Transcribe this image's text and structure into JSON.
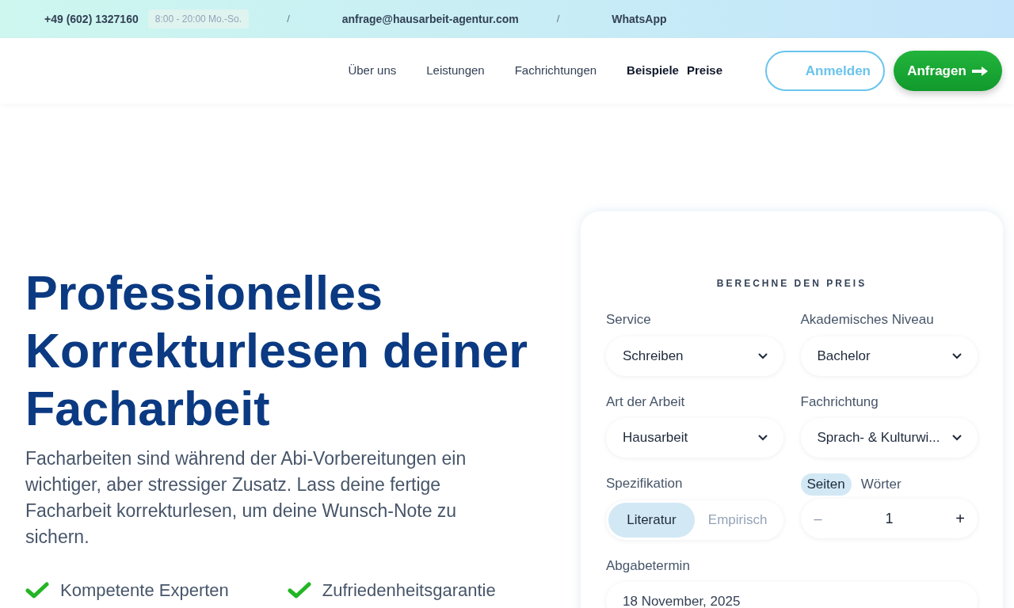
{
  "top_bar": {
    "phone": "+49 (602) 1327160",
    "hours": "8:00 - 20:00 Mo.-So.",
    "separator": "/",
    "email": "anfrage@hausarbeit-agentur.com",
    "whatsapp": "WhatsApp"
  },
  "nav": {
    "links": [
      {
        "label": "Über uns",
        "highlighted": false
      },
      {
        "label": "Leistungen",
        "highlighted": false
      },
      {
        "label": "Fachrichtungen",
        "highlighted": false
      },
      {
        "label": "Beispiele",
        "highlighted": true
      },
      {
        "label": "Preise",
        "highlighted": true
      }
    ],
    "login_button": "Anmelden",
    "request_button": "Anfragen"
  },
  "hero": {
    "title": "Professionelles Korrekturlesen deiner Facharbeit",
    "description": "Facharbeiten sind während der Abi-Vorbereitungen ein wichtiger, aber stressiger Zusatz. Lass deine fertige Facharbeit korrekturlesen, um deine Wunsch-Note zu sichern.",
    "features": [
      "Kompetente Experten",
      "Zufriedenheitsgarantie"
    ]
  },
  "calculator": {
    "title": "BERECHNE DEN PREIS",
    "fields": [
      {
        "kind": "select",
        "label": "Service",
        "value": "Schreiben"
      },
      {
        "kind": "select",
        "label": "Akademisches Niveau",
        "value": "Bachelor"
      },
      {
        "kind": "select",
        "label": "Art der Arbeit",
        "value": "Hausarbeit"
      },
      {
        "kind": "select",
        "label": "Fachrichtung",
        "value": "Sprach- & Kulturwi..."
      },
      {
        "kind": "segmented",
        "label": "Spezifikation",
        "options": [
          {
            "label": "Literatur",
            "selected": true
          },
          {
            "label": "Empirisch",
            "selected": false
          }
        ]
      },
      {
        "kind": "counter",
        "units": [
          {
            "label": "Seiten",
            "selected": true
          },
          {
            "label": "Wörter",
            "selected": false
          }
        ],
        "minus": "–",
        "value": "1",
        "plus": "+",
        "minus_disabled": true
      },
      {
        "kind": "date",
        "label": "Abgabetermin",
        "value": "18 November, 2025"
      }
    ]
  }
}
